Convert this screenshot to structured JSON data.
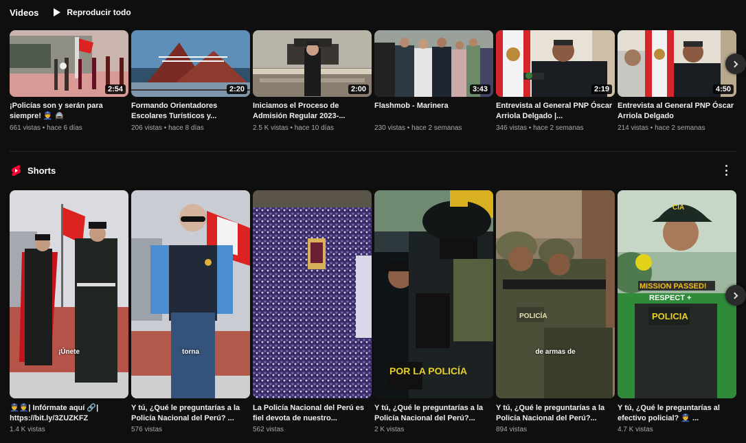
{
  "videos_section": {
    "title": "Videos",
    "play_all_label": "Reproducir todo",
    "items": [
      {
        "title": "¡Policías son y serán para siempre! 👮 🚔",
        "duration": "2:54",
        "meta": "661 vistas • hace 6 días"
      },
      {
        "title": "Formando Orientadores Escolares Turísticos y...",
        "duration": "2:20",
        "meta": "206 vistas • hace 8 días"
      },
      {
        "title": "Iniciamos el Proceso de Admisión Regular 2023-...",
        "duration": "2:00",
        "meta": "2.5 K vistas • hace 10 días"
      },
      {
        "title": "Flashmob - Marinera",
        "duration": "3:43",
        "meta": "230 vistas • hace 2 semanas"
      },
      {
        "title": "Entrevista al General PNP Óscar Arriola Delgado |...",
        "duration": "2:19",
        "meta": "346 vistas • hace 2 semanas"
      },
      {
        "title": "Entrevista al General PNP Óscar Arriola Delgado",
        "duration": "4:50",
        "meta": "214 vistas • hace 2 semanas"
      }
    ]
  },
  "shorts_section": {
    "title": "Shorts",
    "items": [
      {
        "title": "👮👮| Infórmate aquí 🔗| https://bit.ly/3ZUZKFZ",
        "caption": "¡Únete",
        "meta": "1.4 K vistas"
      },
      {
        "title": "Y tú, ¿Qué le preguntarías a la Policía Nacional del Perú? ...",
        "caption": "torna",
        "meta": "576 vistas"
      },
      {
        "title": "La Policía Nacional del Perú es fiel devota de nuestro...",
        "caption": "",
        "meta": "562 vistas"
      },
      {
        "title": "Y tú, ¿Qué le preguntarías a la Policía Nacional del Perú?...",
        "caption": "",
        "meta": "2 K vistas"
      },
      {
        "title": "Y tú, ¿Qué le preguntarías a la Policía Nacional del Perú?...",
        "caption": "de armas de",
        "meta": "894 vistas"
      },
      {
        "title": "Y tú, ¿Qué le preguntarías al efectivo policial? 👮 ...",
        "caption": "",
        "meta": "4.7 K vistas"
      }
    ]
  },
  "thumbnail_text": {
    "short4_vest": "POR LA POLICÍA",
    "short5_vest": "POLICÍA",
    "short6_sticker_1": "MISSION PASSED!",
    "short6_sticker_2": "RESPECT +",
    "short6_vest": "POLICIA",
    "short6_cap": "CIA"
  },
  "icons": {
    "play_all": "play-icon",
    "shorts": "shorts-logo-icon",
    "next": "chevron-right-icon",
    "more": "more-vert-icon"
  },
  "colors": {
    "background": "#0f0f0f",
    "text_primary": "#f1f1f1",
    "text_secondary": "#aaaaaa",
    "shorts_red": "#ff0033"
  }
}
